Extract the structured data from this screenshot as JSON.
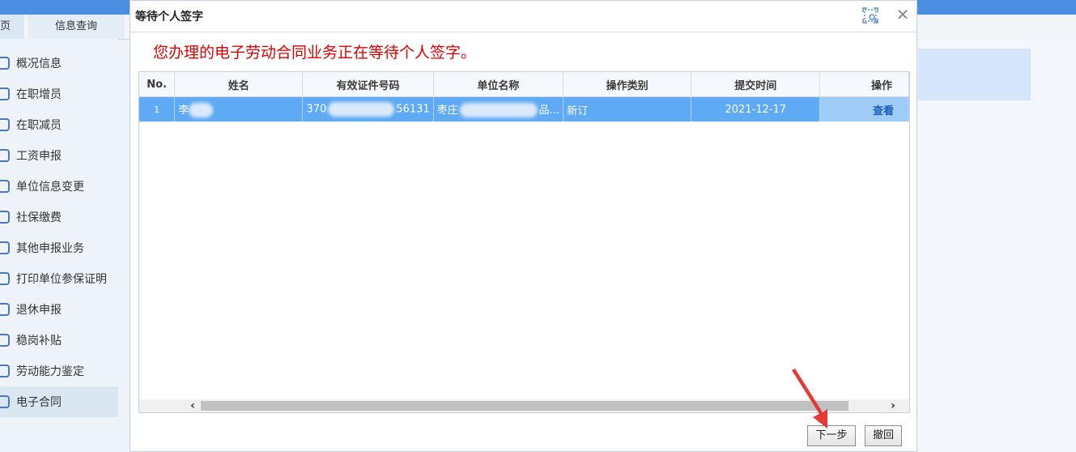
{
  "app": {
    "tabs": [
      "页",
      "信息查询"
    ],
    "sidebar": [
      {
        "label": "概况信息"
      },
      {
        "label": "在职增员"
      },
      {
        "label": "在职减员"
      },
      {
        "label": "工资申报"
      },
      {
        "label": "单位信息变更"
      },
      {
        "label": "社保缴费"
      },
      {
        "label": "其他申报业务"
      },
      {
        "label": "打印单位参保证明"
      },
      {
        "label": "退休申报"
      },
      {
        "label": "稳岗补贴"
      },
      {
        "label": "劳动能力鉴定"
      },
      {
        "label": "电子合同",
        "active": true
      }
    ]
  },
  "dialog": {
    "title": "等待个人签字",
    "message": "您办理的电子劳动合同业务正在等待个人签字。",
    "columns": [
      "No.",
      "姓名",
      "有效证件号码",
      "单位名称",
      "操作类别",
      "提交时间",
      "操作"
    ],
    "rows": [
      {
        "no": "1",
        "name": "李",
        "id_number": "370 56131",
        "id_prefix": "370",
        "id_suffix": "56131",
        "company": "枣庄 品...",
        "company_prefix": "枣庄",
        "company_suffix": "品...",
        "op_type": "新订",
        "submit_time": "2021-12-17",
        "action": "查看"
      }
    ],
    "buttons": {
      "next": "下一步",
      "cancel": "撤回"
    }
  },
  "colors": {
    "accent": "#e00000",
    "selected_row": "#5eaaf4",
    "link": "#1d5fb8",
    "pointer_arrow": "#e53935"
  },
  "icons": {
    "expand": "expand-icon",
    "close": "close-icon"
  }
}
